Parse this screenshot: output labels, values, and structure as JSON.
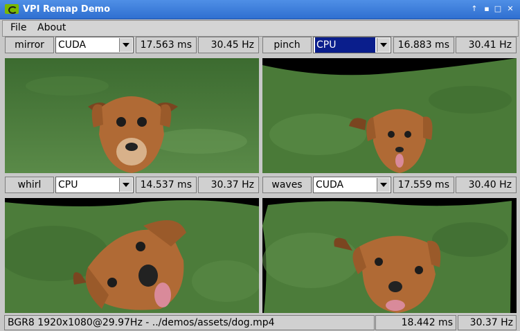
{
  "window": {
    "title": "VPI Remap Demo"
  },
  "menu": {
    "file": "File",
    "about": "About"
  },
  "panels": [
    {
      "name": "mirror",
      "backend": "CUDA",
      "time": "17.563 ms",
      "rate": "30.45 Hz"
    },
    {
      "name": "pinch",
      "backend": "CPU",
      "time": "16.883 ms",
      "rate": "30.41 Hz"
    },
    {
      "name": "whirl",
      "backend": "CPU",
      "time": "14.537 ms",
      "rate": "30.37 Hz"
    },
    {
      "name": "waves",
      "backend": "CUDA",
      "time": "17.559 ms",
      "rate": "30.40 Hz"
    }
  ],
  "status": {
    "source": "BGR8 1920x1080@29.97Hz - ../demos/assets/dog.mp4",
    "time": "18.442 ms",
    "rate": "30.37 Hz"
  },
  "colors": {
    "titlebar": "#2f6fd0",
    "selection": "#0a1e8c",
    "grass": "#4b7a3a",
    "dog": "#b06a35"
  },
  "icons": {
    "app": "nvidia-logo-icon",
    "up": "arrow-up-icon",
    "minimize": "minimize-icon",
    "maximize": "maximize-icon",
    "close": "close-icon"
  }
}
